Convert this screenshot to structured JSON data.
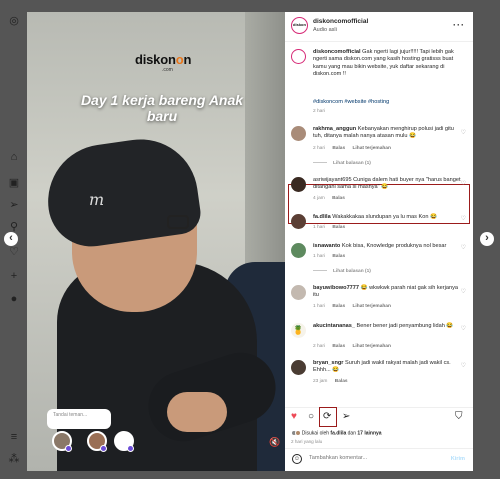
{
  "post": {
    "username": "diskoncomofficial",
    "audio": "Audio asli",
    "caption_user": "diskoncomofficial",
    "caption": "Gak ngerti lagi jujur!!!!! Tapi lebih gak ngerti sama diskon.com yang kasih hosting gratisss buat kamu yang mau bikin website, yuk daftar sekarang di diskon.com !!",
    "hashtags": "#diskoncom #website #hosting",
    "caption_age": "2 hari"
  },
  "video": {
    "brand": "diskon",
    "brand_accent": "o",
    "brand_suffix": "n",
    "brand_sub": ".com",
    "overlay_title": "Day 1 kerja bareng Anak baru",
    "tooltip": "Tandai teman...",
    "volume_icon": "speaker-muted-icon"
  },
  "comments": [
    {
      "user": "rakhma_anggun",
      "text": "Kebanyakan menghirup polusi jadi gitu tuh, ditanya malah nanya atasan mulu 😂",
      "age": "2 hari",
      "reply": "Balas",
      "translate": "Lihat terjemahan",
      "replies": "Lihat balasan (1)"
    },
    {
      "user": "asriwijayant695",
      "text": "Cuniga dalem hati buyer nya \"harus banget ditangani sama si masnya\" 😂",
      "age": "4 jam",
      "reply": "Balas"
    },
    {
      "user": "fa.dlila",
      "text": "Wakakkakaa slundupan ya lu mas Kon 😂",
      "age": "1 hari",
      "reply": "Balas"
    },
    {
      "user": "isnawanto",
      "text": "Kok bisa, Knowledge produknya nol besar",
      "age": "1 hari",
      "reply": "Balas",
      "replies": "Lihat balasan (1)"
    },
    {
      "user": "bayuwibowo7777",
      "text": "😂 wkwkwk parah niat gak sih kerjanya itu",
      "age": "1 hari",
      "reply": "Balas",
      "translate": "Lihat terjemahan"
    },
    {
      "user": "akucintananas_",
      "text": "Bener bener jadi penyambung lidah 😂",
      "age": "2 hari",
      "reply": "Balas",
      "translate": "Lihat terjemahan"
    },
    {
      "user": "bryan_sngr",
      "text": "Suruh jadi wakil rakyat malah jadi wakil cs. Ehhh... 😂",
      "age": "23 jam",
      "reply": "Balas"
    }
  ],
  "actions": {
    "liked_prefix": "Disukai oleh",
    "liked_user": "fa.dlila",
    "liked_and": "dan",
    "liked_count": "17 lainnya",
    "time_ago": "2 hari yang lalu"
  },
  "add_comment": {
    "placeholder": "Tambahkan komentar...",
    "post_label": "Kirim"
  },
  "colors": {
    "like": "#ed4956",
    "highlight": "#9b1b1b",
    "link": "#00376b"
  }
}
